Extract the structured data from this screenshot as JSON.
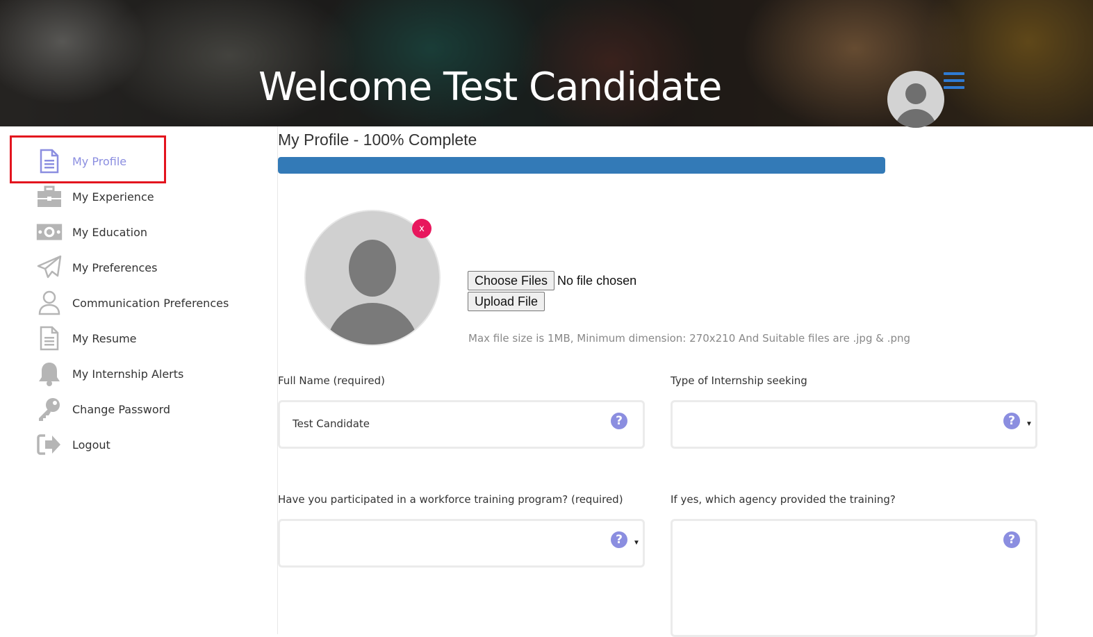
{
  "header": {
    "title": "Welcome Test Candidate",
    "menu_icon": "hamburger-icon",
    "avatar_icon": "user-avatar-icon"
  },
  "sidebar": {
    "items": [
      {
        "label": "My Profile",
        "icon": "document-icon",
        "active": true
      },
      {
        "label": "My Experience",
        "icon": "briefcase-icon"
      },
      {
        "label": "My Education",
        "icon": "money-icon"
      },
      {
        "label": "My Preferences",
        "icon": "paper-plane-icon"
      },
      {
        "label": "Communication Preferences",
        "icon": "user-icon"
      },
      {
        "label": "My Resume",
        "icon": "document-icon"
      },
      {
        "label": "My Internship Alerts",
        "icon": "bell-icon"
      },
      {
        "label": "Change Password",
        "icon": "key-icon"
      },
      {
        "label": "Logout",
        "icon": "logout-icon"
      }
    ]
  },
  "profile": {
    "title": "My Profile - 100% Complete",
    "progress": 1.0,
    "remove_label": "x",
    "choose_files_label": "Choose Files",
    "file_status": "No file chosen",
    "upload_label": "Upload File",
    "hint": "Max file size is 1MB, Minimum dimension: 270x210 And Suitable files are .jpg & .png"
  },
  "form": {
    "full_name_label": "Full Name (required)",
    "full_name_value": "Test Candidate",
    "internship_type_label": "Type of Internship seeking",
    "internship_type_value": "",
    "workforce_label": "Have you participated in a workforce training program? (required)",
    "workforce_value": "",
    "agency_label": "If yes, which agency provided the training?",
    "agency_value": "",
    "help_glyph": "?"
  },
  "colors": {
    "accent": "#8b8ee0",
    "progress": "#337ab7",
    "remove": "#e8175d",
    "highlight": "#e3141e",
    "menu": "#2f7bd3"
  }
}
